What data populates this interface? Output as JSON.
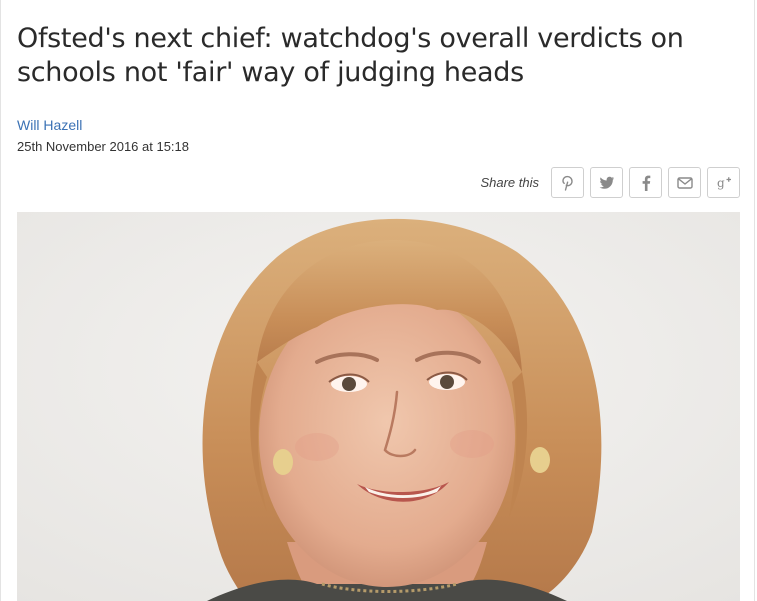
{
  "article": {
    "headline": "Ofsted's next chief: watchdog's overall verdicts on schools not 'fair' way of judging heads",
    "author": "Will Hazell",
    "date": "25th November 2016 at 15:18"
  },
  "share": {
    "label": "Share this",
    "buttons": [
      {
        "icon": "pinterest-icon"
      },
      {
        "icon": "twitter-icon"
      },
      {
        "icon": "facebook-icon"
      },
      {
        "icon": "email-icon"
      },
      {
        "icon": "google-plus-icon"
      }
    ]
  },
  "colors": {
    "author_link": "#3b72b5",
    "icon": "#8a8a8a",
    "button_border": "#cfcfcf"
  }
}
